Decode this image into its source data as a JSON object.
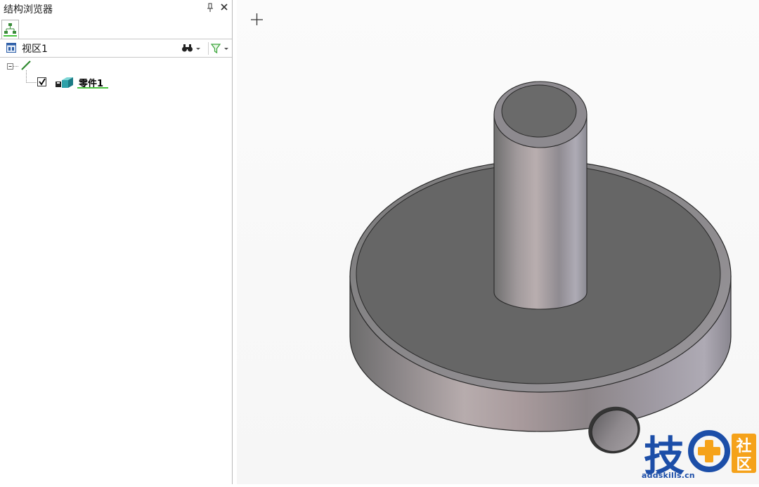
{
  "panel": {
    "title": "结构浏览器",
    "pin_icon": "pin-icon",
    "close_icon": "close-icon",
    "tab_icon": "structure-tree-icon"
  },
  "view": {
    "label": "视区1",
    "find_icon": "binoculars-icon",
    "filter_icon": "filter-icon"
  },
  "tree": {
    "part_label": "零件1",
    "part_checked": true
  },
  "watermark": {
    "char_main": "技",
    "char_top": "社",
    "char_bottom": "区",
    "url": "addskills.cn"
  },
  "colors": {
    "underline": "#49c43f",
    "watermark_blue": "#1c4ea8",
    "watermark_orange": "#f5a21a"
  }
}
